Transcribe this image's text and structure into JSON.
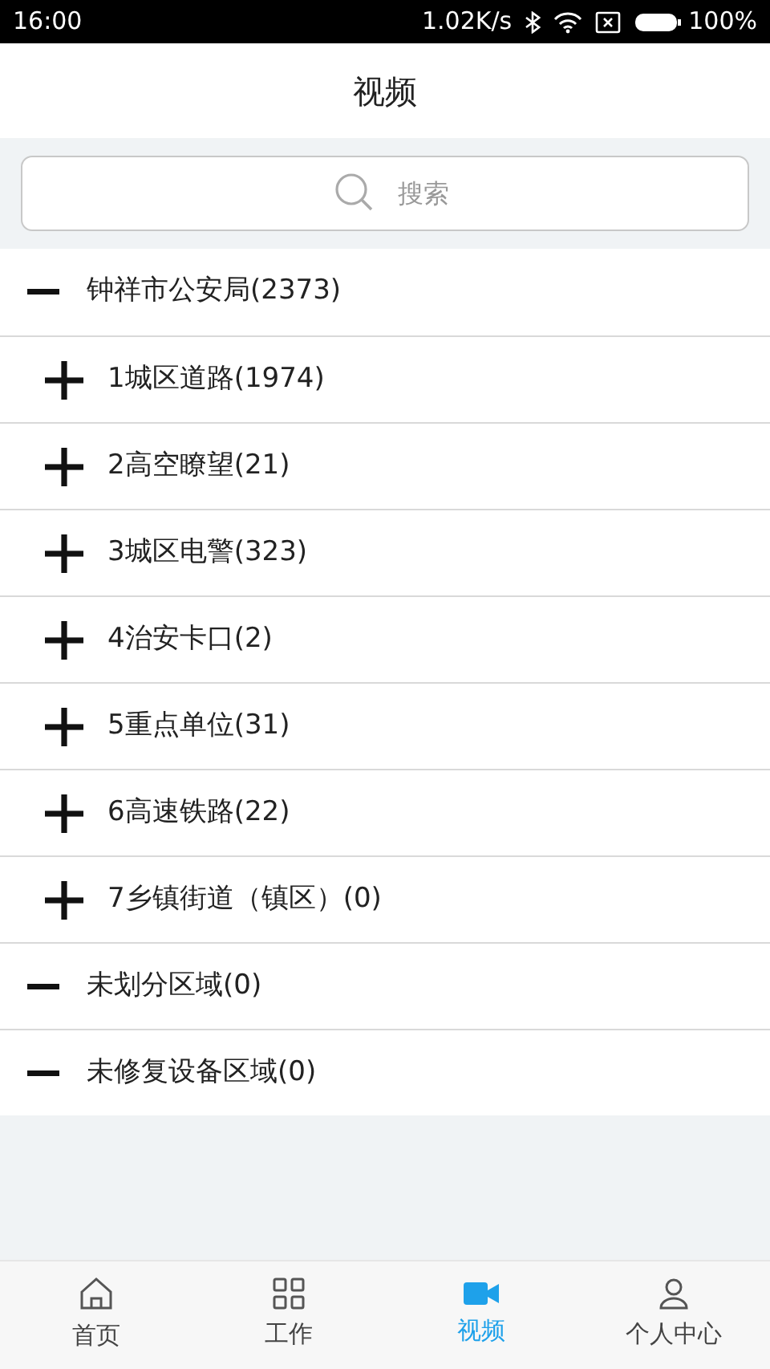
{
  "status_bar": {
    "time": "16:00",
    "speed": "1.02K/s",
    "battery": "100%"
  },
  "header": {
    "title": "视频"
  },
  "search": {
    "placeholder": "搜索"
  },
  "tree": [
    {
      "label": "钟祥市公安局(2373)",
      "expanded": true,
      "children": [
        {
          "label": "1城区道路(1974)",
          "expanded": false
        },
        {
          "label": "2高空瞭望(21)",
          "expanded": false
        },
        {
          "label": "3城区电警(323)",
          "expanded": false
        },
        {
          "label": "4治安卡口(2)",
          "expanded": false
        },
        {
          "label": "5重点单位(31)",
          "expanded": false
        },
        {
          "label": "6高速铁路(22)",
          "expanded": false
        },
        {
          "label": "7乡镇街道（镇区）(0)",
          "expanded": false
        }
      ]
    },
    {
      "label": "未划分区域(0)",
      "expanded": true
    },
    {
      "label": "未修复设备区域(0)",
      "expanded": true
    }
  ],
  "bottom_nav": [
    {
      "label": "首页",
      "selected": false
    },
    {
      "label": "工作",
      "selected": false
    },
    {
      "label": "视频",
      "selected": true
    },
    {
      "label": "个人中心",
      "selected": false
    }
  ]
}
